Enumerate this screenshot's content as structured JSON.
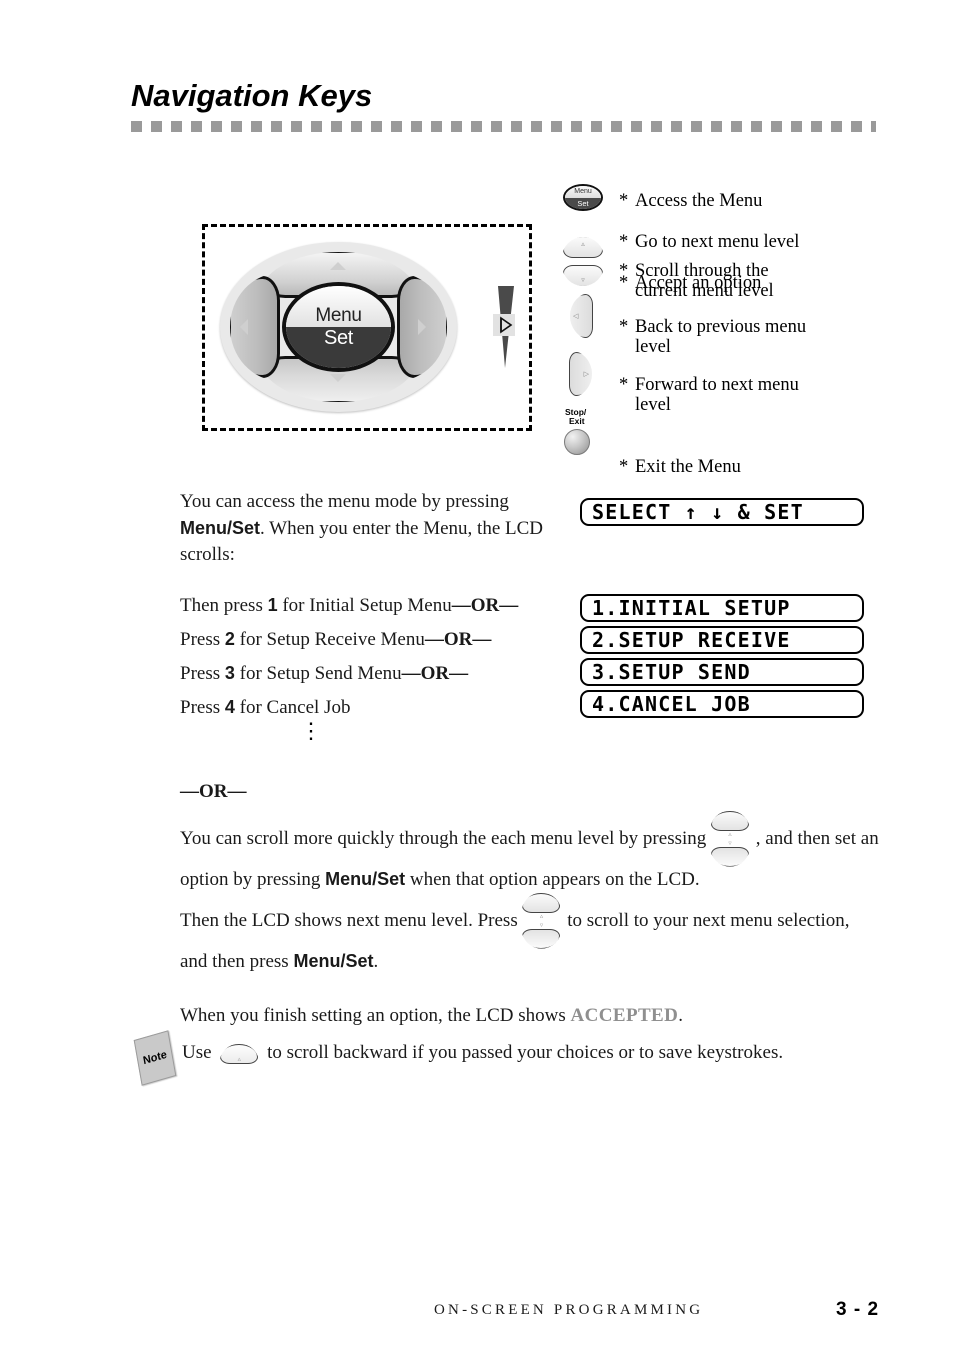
{
  "header": {
    "title": "Navigation Keys"
  },
  "figure": {
    "navpad": {
      "center_top_label": "Menu",
      "center_bottom_label": "Set",
      "up_arrow": "▲",
      "down_arrow": "▼",
      "left_arrow": "◀",
      "right_arrow": "▶"
    },
    "speaker_icon": "speaker-volume-icon"
  },
  "legend": [
    {
      "icon": "menu-set-key-icon",
      "icon_top_label": "Menu",
      "icon_bottom_label": "Set",
      "bullets": [
        "Access the Menu",
        "Go to next menu level",
        "Accept an option"
      ]
    },
    {
      "icon": "up-down-scroll-keys-icon",
      "bullets": [
        "Scroll through the\ncurrent menu level"
      ]
    },
    {
      "icon": "left-arrow-key-icon",
      "bullets": [
        "Back to previous menu\nlevel"
      ]
    },
    {
      "icon": "right-arrow-key-icon",
      "bullets": [
        "Forward to next menu\nlevel"
      ]
    },
    {
      "icon": "stop-exit-key-icon",
      "icon_label_line1": "Stop/",
      "icon_label_line2": "Exit",
      "bullets": [
        "Exit the Menu"
      ]
    }
  ],
  "body": {
    "intro_part1": "You can access the menu mode by pressing ",
    "intro_bold": "Menu/Set",
    "intro_part2": ". When you enter the Menu, the LCD scrolls:",
    "steps": [
      {
        "pre": "Then press ",
        "num": "1",
        "mid": " for Initial Setup Menu",
        "or": "—OR—"
      },
      {
        "pre": "Press ",
        "num": "2",
        "mid": " for Setup Receive Menu",
        "or": "—OR—"
      },
      {
        "pre": "Press ",
        "num": "3",
        "mid": " for Setup Send Menu",
        "or": "—OR—"
      },
      {
        "pre": "Press ",
        "num": "4",
        "mid": " for Cancel Job",
        "or": ""
      }
    ],
    "ellipsis": "⋮",
    "or_divider": "—OR—",
    "scroll_p1_a": "You can scroll more quickly through the each menu level by pressing",
    "scroll_p1_b": ", and then set an option by pressing",
    "scroll_p1_bold": "Menu/Set",
    "scroll_p1_c": "when that option appears on the LCD.",
    "scroll_p2_a": "Then the LCD shows next menu level. Press",
    "scroll_p2_b": "to scroll to your next menu selection, and then press",
    "scroll_p2_bold": "Menu/Set",
    "scroll_p2_c": ".",
    "or_inline": "or",
    "accepted_pre": "When you finish setting an option, the LCD shows ",
    "accepted_word": "ACCEPTED",
    "accepted_post": ".",
    "note_icon_label": "Note",
    "note_pre": "Use",
    "note_post": "to scroll backward if you passed your choices or to save keystrokes."
  },
  "lcd": {
    "scroll_display": "SELECT ↑ ↓ & SET",
    "menu_items": [
      "1.INITIAL SETUP",
      "2.SETUP RECEIVE",
      "3.SETUP SEND",
      "4.CANCEL JOB"
    ]
  },
  "footer": {
    "section": "ON-SCREEN PROGRAMMING",
    "page": "3 - 2"
  },
  "colors": {
    "rule": "#9a9a9a",
    "accepted": "#8f8f8f",
    "key_dark": "#3a3a3a"
  }
}
